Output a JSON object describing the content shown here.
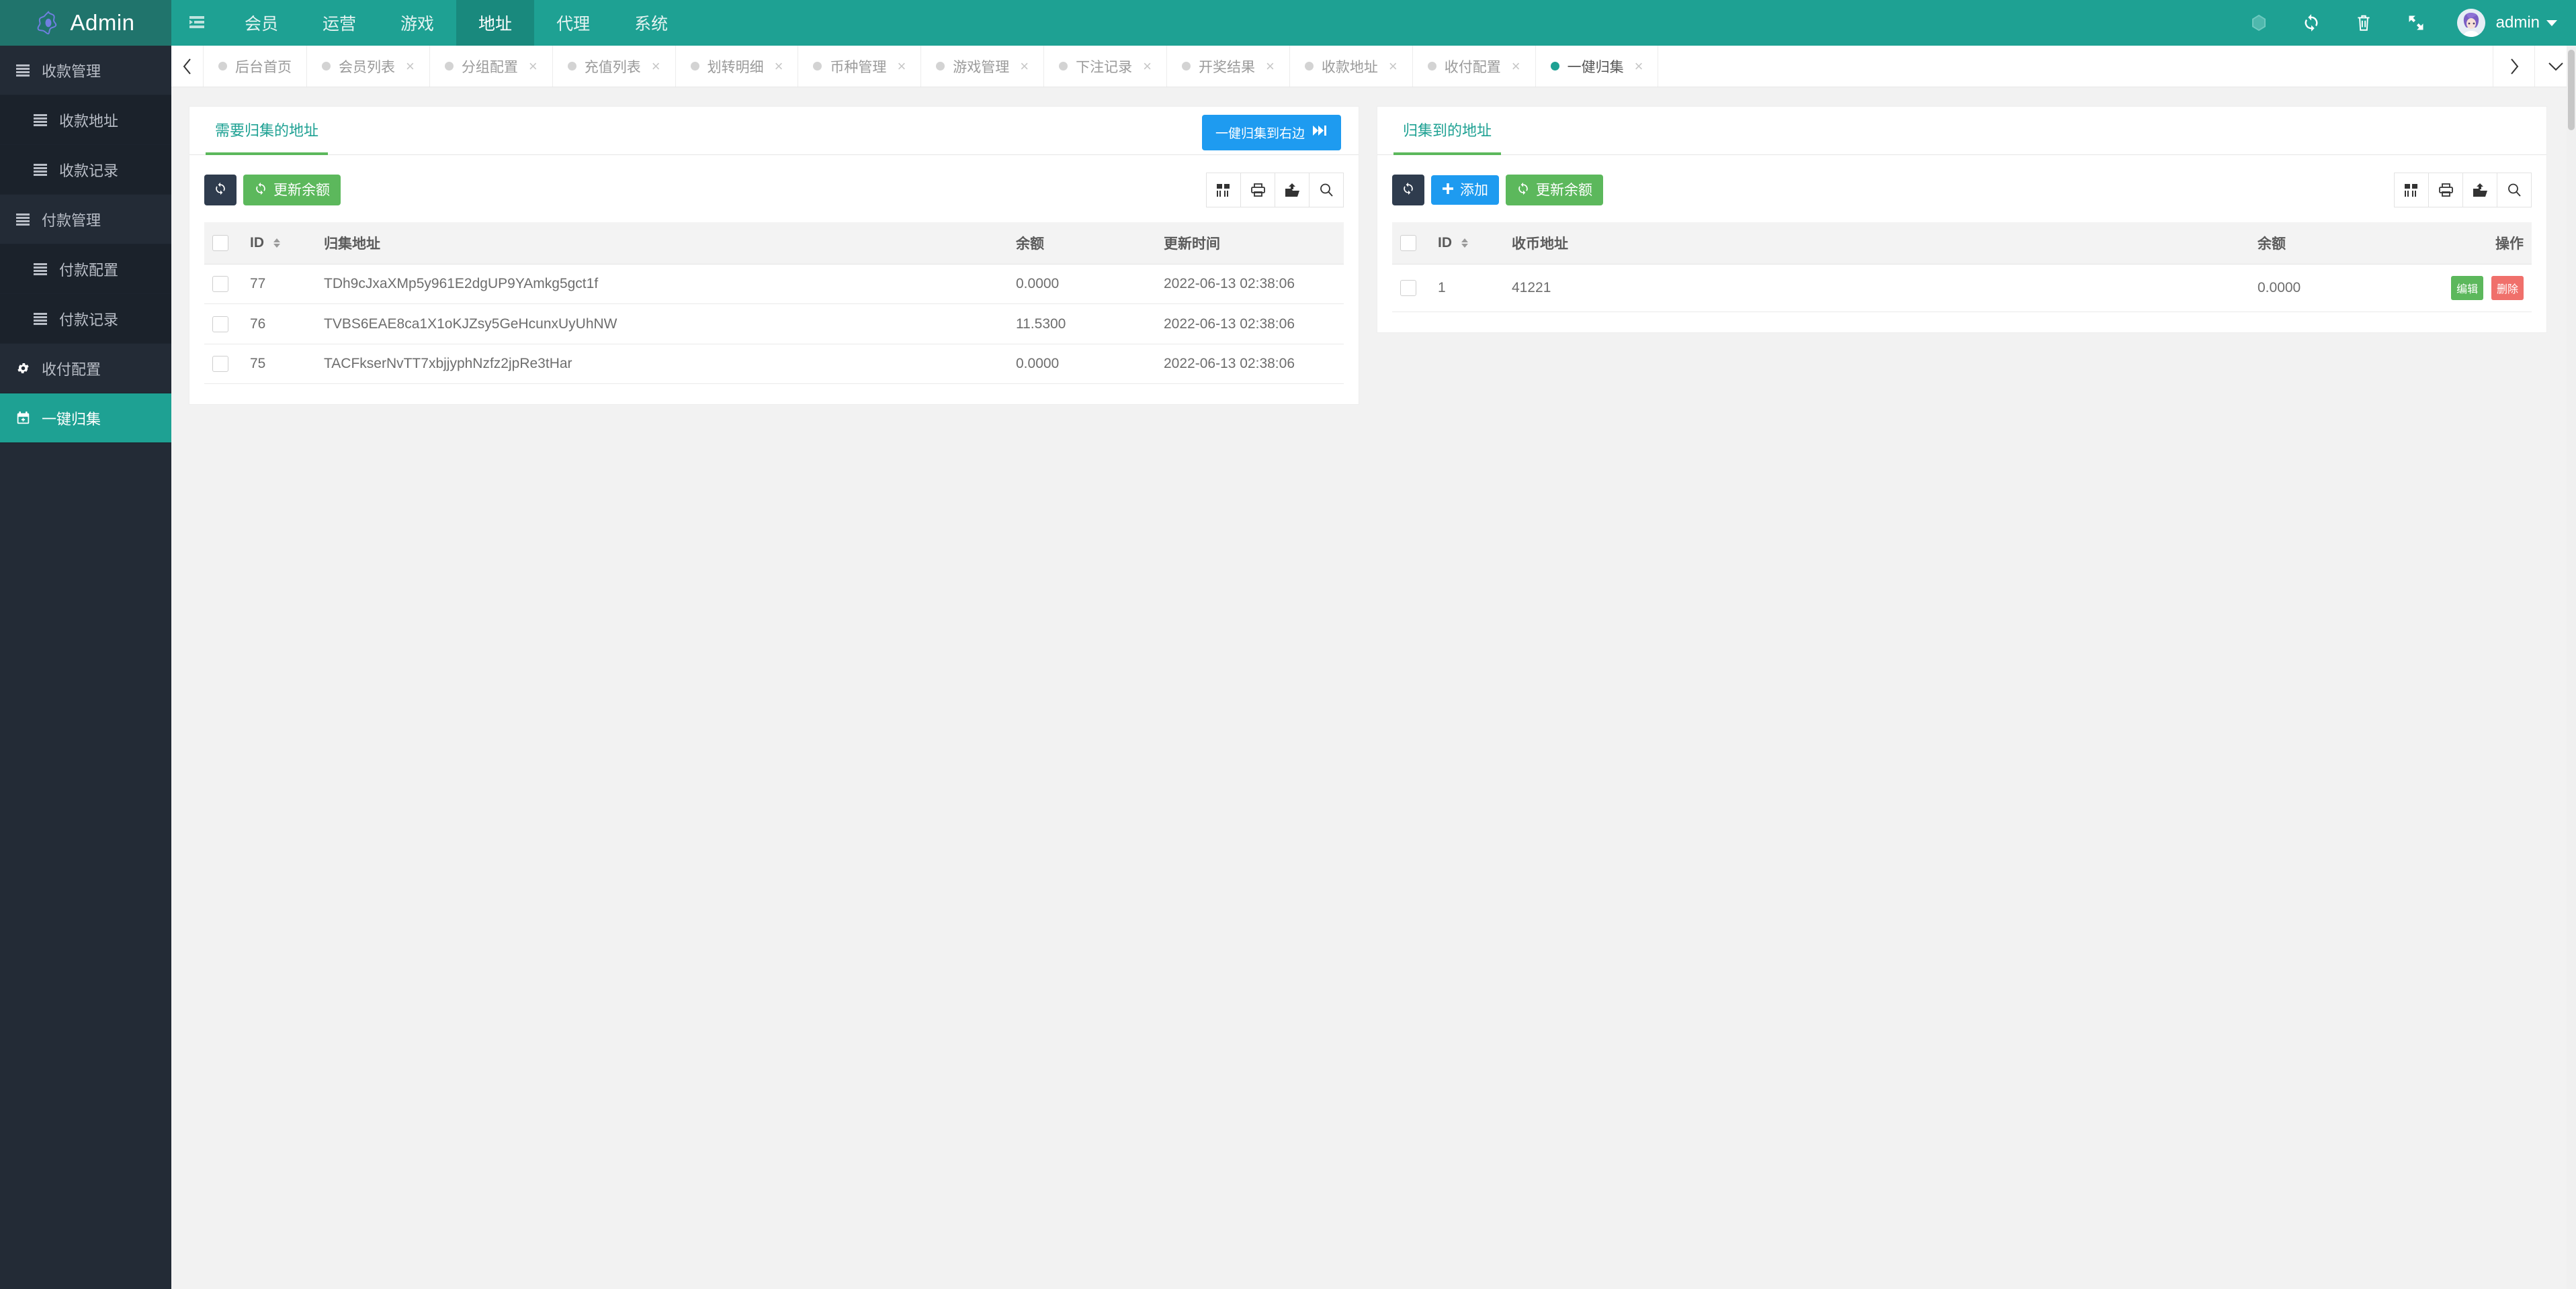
{
  "topnav": {
    "brand": "Admin",
    "toggle_icon": "sidebar-collapse-icon",
    "items": [
      {
        "label": "会员",
        "active": false
      },
      {
        "label": "运营",
        "active": false
      },
      {
        "label": "游戏",
        "active": false
      },
      {
        "label": "地址",
        "active": true
      },
      {
        "label": "代理",
        "active": false
      },
      {
        "label": "系统",
        "active": false
      }
    ],
    "right_icons": [
      "theme-icon",
      "refresh-icon",
      "trash-icon",
      "fullscreen-icon"
    ],
    "username": "admin"
  },
  "sidebar": {
    "items": [
      {
        "label": "收款管理",
        "icon": "list-icon",
        "sub": false,
        "active": false
      },
      {
        "label": "收款地址",
        "icon": "list-icon",
        "sub": true,
        "active": false
      },
      {
        "label": "收款记录",
        "icon": "list-icon",
        "sub": true,
        "active": false
      },
      {
        "label": "付款管理",
        "icon": "list-icon",
        "sub": false,
        "active": false
      },
      {
        "label": "付款配置",
        "icon": "list-icon",
        "sub": true,
        "active": false
      },
      {
        "label": "付款记录",
        "icon": "list-icon",
        "sub": true,
        "active": false
      },
      {
        "label": "收付配置",
        "icon": "gear-icon",
        "sub": false,
        "active": false
      },
      {
        "label": "一键归集",
        "icon": "calendar-plus-icon",
        "sub": false,
        "active": true
      }
    ]
  },
  "tabbar": {
    "prev_icon": "chevron-left-icon",
    "next_icon": "chevron-right-icon",
    "menu_icon": "chevron-down-icon",
    "close_glyph": "×",
    "tabs": [
      {
        "label": "后台首页",
        "closable": false,
        "active": false
      },
      {
        "label": "会员列表",
        "closable": true,
        "active": false
      },
      {
        "label": "分组配置",
        "closable": true,
        "active": false
      },
      {
        "label": "充值列表",
        "closable": true,
        "active": false
      },
      {
        "label": "划转明细",
        "closable": true,
        "active": false
      },
      {
        "label": "币种管理",
        "closable": true,
        "active": false
      },
      {
        "label": "游戏管理",
        "closable": true,
        "active": false
      },
      {
        "label": "下注记录",
        "closable": true,
        "active": false
      },
      {
        "label": "开奖结果",
        "closable": true,
        "active": false
      },
      {
        "label": "收款地址",
        "closable": true,
        "active": false
      },
      {
        "label": "收付配置",
        "closable": true,
        "active": false
      },
      {
        "label": "一健归集",
        "closable": true,
        "active": true
      }
    ]
  },
  "left_panel": {
    "tab_label": "需要归集的地址",
    "action_button": "一健归集到右边",
    "action_icon": "fast-forward-icon",
    "toolbar": {
      "refresh_icon": "refresh-icon",
      "update_balance_label": "更新余额",
      "icons": [
        "columns-icon",
        "print-icon",
        "export-icon",
        "search-icon"
      ]
    },
    "table": {
      "columns": [
        "",
        "ID",
        "归集地址",
        "余额",
        "更新时间"
      ],
      "rows": [
        {
          "id": "77",
          "address": "TDh9cJxaXMp5y961E2dgUP9YAmkg5gct1f",
          "balance": "0.0000",
          "updated": "2022-06-13 02:38:06"
        },
        {
          "id": "76",
          "address": "TVBS6EAE8ca1X1oKJZsy5GeHcunxUyUhNW",
          "balance": "11.5300",
          "updated": "2022-06-13 02:38:06"
        },
        {
          "id": "75",
          "address": "TACFkserNvTT7xbjjyphNzfz2jpRe3tHar",
          "balance": "0.0000",
          "updated": "2022-06-13 02:38:06"
        }
      ]
    }
  },
  "right_panel": {
    "tab_label": "归集到的地址",
    "toolbar": {
      "refresh_icon": "refresh-icon",
      "add_label": "添加",
      "update_balance_label": "更新余额",
      "icons": [
        "columns-icon",
        "print-icon",
        "export-icon",
        "search-icon"
      ]
    },
    "table": {
      "columns": [
        "",
        "ID",
        "收币地址",
        "余额",
        "操作"
      ],
      "rows": [
        {
          "id": "1",
          "address": "41221",
          "balance": "0.0000",
          "edit": "编辑",
          "delete": "删除"
        }
      ]
    }
  },
  "colors": {
    "brand_teal": "#1ea193",
    "brand_teal_dark": "#20746c",
    "sidebar_bg": "#232b36",
    "green": "#5cb85c",
    "blue": "#1e9bf0",
    "red": "#f0706b"
  }
}
